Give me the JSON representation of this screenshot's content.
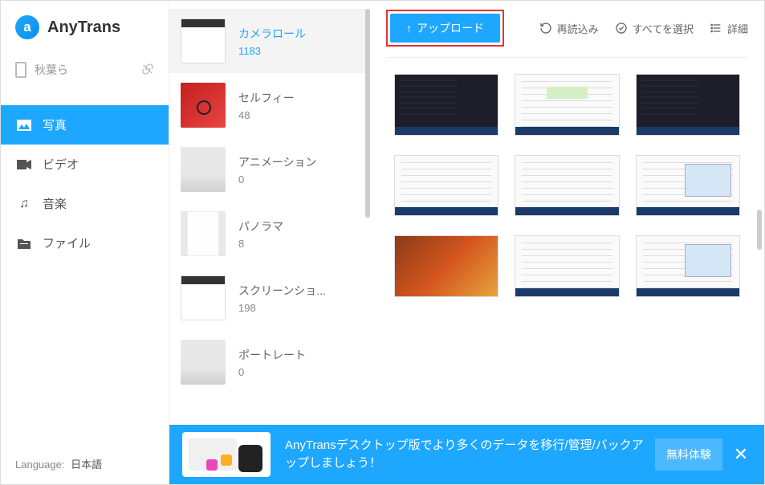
{
  "app": {
    "name": "AnyTrans",
    "logo_letter": "a"
  },
  "device": {
    "name": "秋葉ら"
  },
  "nav": [
    {
      "key": "photos",
      "label": "写真",
      "active": true
    },
    {
      "key": "video",
      "label": "ビデオ",
      "active": false
    },
    {
      "key": "music",
      "label": "音楽",
      "active": false
    },
    {
      "key": "file",
      "label": "ファイル",
      "active": false
    }
  ],
  "language": {
    "label": "Language:",
    "value": "日本語"
  },
  "albums": [
    {
      "name": "カメラロール",
      "count": 1183,
      "selected": true,
      "thumb": "doc"
    },
    {
      "name": "セルフィー",
      "count": 48,
      "selected": false,
      "thumb": "red"
    },
    {
      "name": "アニメーション",
      "count": 0,
      "selected": false,
      "thumb": "gray"
    },
    {
      "name": "パノラマ",
      "count": 8,
      "selected": false,
      "thumb": "pano"
    },
    {
      "name": "スクリーンショ...",
      "count": 198,
      "selected": false,
      "thumb": "doc"
    },
    {
      "name": "ポートレート",
      "count": 0,
      "selected": false,
      "thumb": "gray"
    }
  ],
  "toolbar": {
    "upload": "アップロード",
    "reload": "再読込み",
    "select_all": "すべてを選択",
    "detail": "詳細"
  },
  "photos": [
    {
      "style": "dark"
    },
    {
      "style": "light-green"
    },
    {
      "style": "dark"
    },
    {
      "style": "light"
    },
    {
      "style": "light"
    },
    {
      "style": "light-blue"
    },
    {
      "style": "food"
    },
    {
      "style": "light"
    },
    {
      "style": "light-blue"
    }
  ],
  "banner": {
    "text": "AnyTransデスクトップ版でより多くのデータを移行/管理/バックアップしましょう！",
    "cta": "無料体験"
  }
}
